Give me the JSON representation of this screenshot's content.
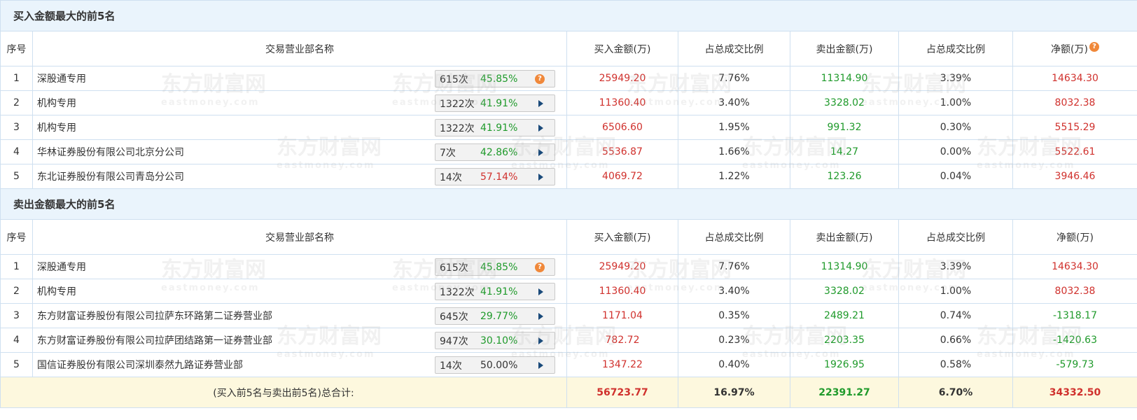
{
  "columns": {
    "seq": "序号",
    "name": "交易营业部名称",
    "buy": "买入金额(万)",
    "buy_ratio": "占总成交比例",
    "sell": "卖出金额(万)",
    "sell_ratio": "占总成交比例",
    "net": "净额(万)"
  },
  "buy_section": {
    "title": "买入金额最大的前5名",
    "rows": [
      {
        "seq": "1",
        "name": "深股通专用",
        "count": "615次",
        "pct": "45.85%",
        "pct_color": "green",
        "action": "help",
        "buy": "25949.20",
        "buy_ratio": "7.76%",
        "sell": "11314.90",
        "sell_ratio": "3.39%",
        "net": "14634.30"
      },
      {
        "seq": "2",
        "name": "机构专用",
        "count": "1322次",
        "pct": "41.91%",
        "pct_color": "green",
        "action": "expand",
        "buy": "11360.40",
        "buy_ratio": "3.40%",
        "sell": "3328.02",
        "sell_ratio": "1.00%",
        "net": "8032.38"
      },
      {
        "seq": "3",
        "name": "机构专用",
        "count": "1322次",
        "pct": "41.91%",
        "pct_color": "green",
        "action": "expand",
        "buy": "6506.60",
        "buy_ratio": "1.95%",
        "sell": "991.32",
        "sell_ratio": "0.30%",
        "net": "5515.29"
      },
      {
        "seq": "4",
        "name": "华林证券股份有限公司北京分公司",
        "count": "7次",
        "pct": "42.86%",
        "pct_color": "green",
        "action": "expand",
        "buy": "5536.87",
        "buy_ratio": "1.66%",
        "sell": "14.27",
        "sell_ratio": "0.00%",
        "net": "5522.61"
      },
      {
        "seq": "5",
        "name": "东北证券股份有限公司青岛分公司",
        "count": "14次",
        "pct": "57.14%",
        "pct_color": "red",
        "action": "expand",
        "buy": "4069.72",
        "buy_ratio": "1.22%",
        "sell": "123.26",
        "sell_ratio": "0.04%",
        "net": "3946.46"
      }
    ]
  },
  "sell_section": {
    "title": "卖出金额最大的前5名",
    "rows": [
      {
        "seq": "1",
        "name": "深股通专用",
        "count": "615次",
        "pct": "45.85%",
        "pct_color": "green",
        "action": "help",
        "buy": "25949.20",
        "buy_ratio": "7.76%",
        "sell": "11314.90",
        "sell_ratio": "3.39%",
        "net": "14634.30",
        "net_color": "red"
      },
      {
        "seq": "2",
        "name": "机构专用",
        "count": "1322次",
        "pct": "41.91%",
        "pct_color": "green",
        "action": "expand",
        "buy": "11360.40",
        "buy_ratio": "3.40%",
        "sell": "3328.02",
        "sell_ratio": "1.00%",
        "net": "8032.38",
        "net_color": "red"
      },
      {
        "seq": "3",
        "name": "东方财富证券股份有限公司拉萨东环路第二证券营业部",
        "count": "645次",
        "pct": "29.77%",
        "pct_color": "green",
        "action": "expand",
        "buy": "1171.04",
        "buy_ratio": "0.35%",
        "sell": "2489.21",
        "sell_ratio": "0.74%",
        "net": "-1318.17",
        "net_color": "green"
      },
      {
        "seq": "4",
        "name": "东方财富证券股份有限公司拉萨团结路第一证券营业部",
        "count": "947次",
        "pct": "30.10%",
        "pct_color": "green",
        "action": "expand",
        "buy": "782.72",
        "buy_ratio": "0.23%",
        "sell": "2203.35",
        "sell_ratio": "0.66%",
        "net": "-1420.63",
        "net_color": "green"
      },
      {
        "seq": "5",
        "name": "国信证券股份有限公司深圳泰然九路证券营业部",
        "count": "14次",
        "pct": "50.00%",
        "pct_color": "gray",
        "action": "expand",
        "buy": "1347.22",
        "buy_ratio": "0.40%",
        "sell": "1926.95",
        "sell_ratio": "0.58%",
        "net": "-579.73",
        "net_color": "green"
      }
    ]
  },
  "total": {
    "label": "(买入前5名与卖出前5名)总合计:",
    "buy": "56723.77",
    "buy_ratio": "16.97%",
    "sell": "22391.27",
    "sell_ratio": "6.70%",
    "net": "34332.50"
  },
  "colors": {
    "red": "#d0312d",
    "green": "#1f9a2b",
    "gray": "#333333",
    "section_bg": "#eaf4fc",
    "total_bg": "#fdf8de",
    "help_icon": "#f0883a",
    "expand_arrow": "#1a4a7a"
  },
  "icons": {
    "help": "question-circle-icon",
    "expand": "play-arrow-icon"
  },
  "watermark": {
    "text": "东方财富网",
    "sub": "eastmoney.com"
  }
}
